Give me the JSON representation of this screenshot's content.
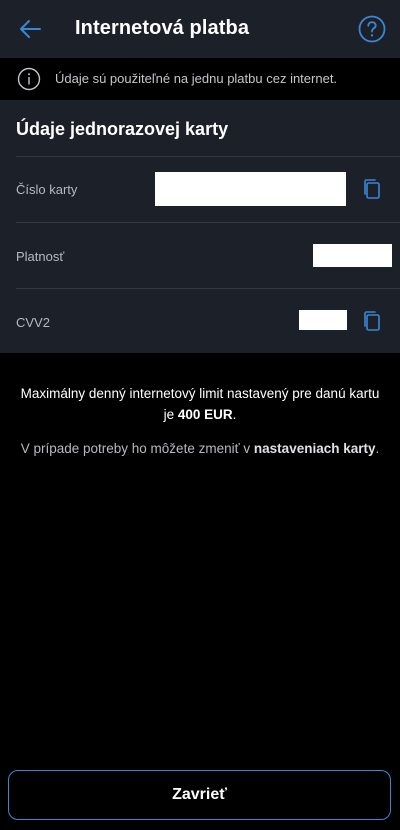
{
  "header": {
    "title": "Internetová platba",
    "back_icon": "arrow-left-icon",
    "help_icon": "question-circle-icon"
  },
  "banner": {
    "icon": "info-circle-icon",
    "text": "Údaje sú použiteľné na jednu platbu cez internet."
  },
  "card": {
    "title": "Údaje jednorazovej karty",
    "rows": [
      {
        "label": "Číslo karty",
        "value": "",
        "copy_icon": "copy-icon"
      },
      {
        "label": "Platnosť",
        "value": ""
      },
      {
        "label": "CVV2",
        "value": "",
        "copy_icon": "copy-icon"
      }
    ]
  },
  "limit": {
    "text_before": "Maximálny denný internetový limit nastavený pre danú kartu je",
    "amount": "400 EUR",
    "text_after": "."
  },
  "change": {
    "text_before": "V prípade potreby ho môžete zmeniť v",
    "link": "nastaveniach karty",
    "text_after": "."
  },
  "footer": {
    "close_label": "Zavrieť"
  },
  "colors": {
    "accent": "#3d86d6",
    "panel_bg": "#1c2029",
    "page_bg": "#000000"
  }
}
